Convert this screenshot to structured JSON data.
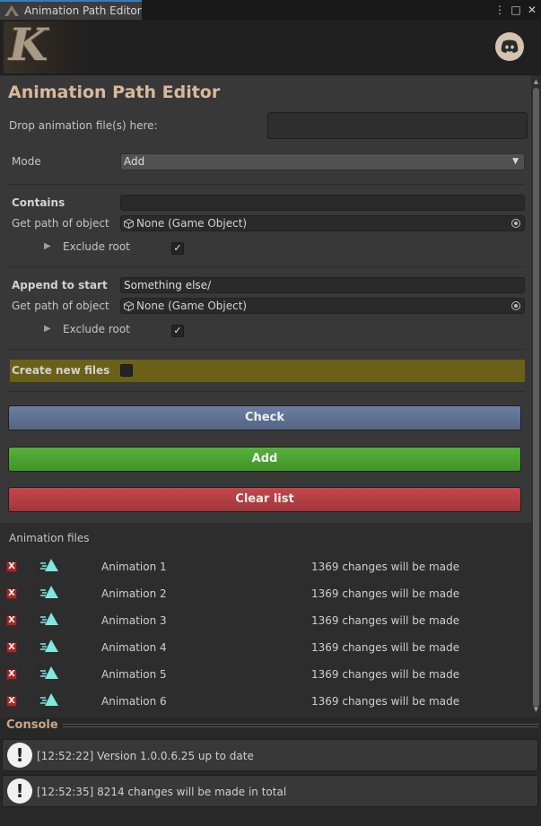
{
  "tab": {
    "title": "Animation Path Editor"
  },
  "header": {
    "logo_letter": "K"
  },
  "editor": {
    "title": "Animation Path Editor",
    "drop_label": "Drop animation file(s) here:",
    "mode_label": "Mode",
    "mode_value": "Add",
    "contains": {
      "label": "Contains",
      "value": "",
      "get_path_label": "Get path of object",
      "object_value": "None (Game Object)",
      "exclude_root_label": "Exclude root",
      "exclude_root_checked": true
    },
    "append": {
      "label": "Append to start",
      "value": "Something else/",
      "get_path_label": "Get path of object",
      "object_value": "None (Game Object)",
      "exclude_root_label": "Exclude root",
      "exclude_root_checked": true
    },
    "create_new_files_label": "Create new files",
    "buttons": {
      "check": "Check",
      "add": "Add",
      "clear": "Clear list"
    },
    "files_label": "Animation files",
    "files": [
      {
        "name": "Animation 1",
        "changes": "1369 changes will be made"
      },
      {
        "name": "Animation 2",
        "changes": "1369 changes will be made"
      },
      {
        "name": "Animation 3",
        "changes": "1369 changes will be made"
      },
      {
        "name": "Animation 4",
        "changes": "1369 changes will be made"
      },
      {
        "name": "Animation 5",
        "changes": "1369 changes will be made"
      },
      {
        "name": "Animation 6",
        "changes": "1369 changes will be made"
      }
    ],
    "remove_label": "X"
  },
  "console": {
    "title": "Console",
    "messages": [
      "[12:52:22] Version 1.0.0.6.25 up to date",
      "[12:52:35] 8214 changes will be made in total"
    ]
  },
  "colors": {
    "title": "#d9b99b",
    "check": "#5f7194",
    "add": "#4ba331",
    "clear": "#b33f44",
    "highlight": "#6a6017",
    "anim_icon": "#7fe8df"
  }
}
